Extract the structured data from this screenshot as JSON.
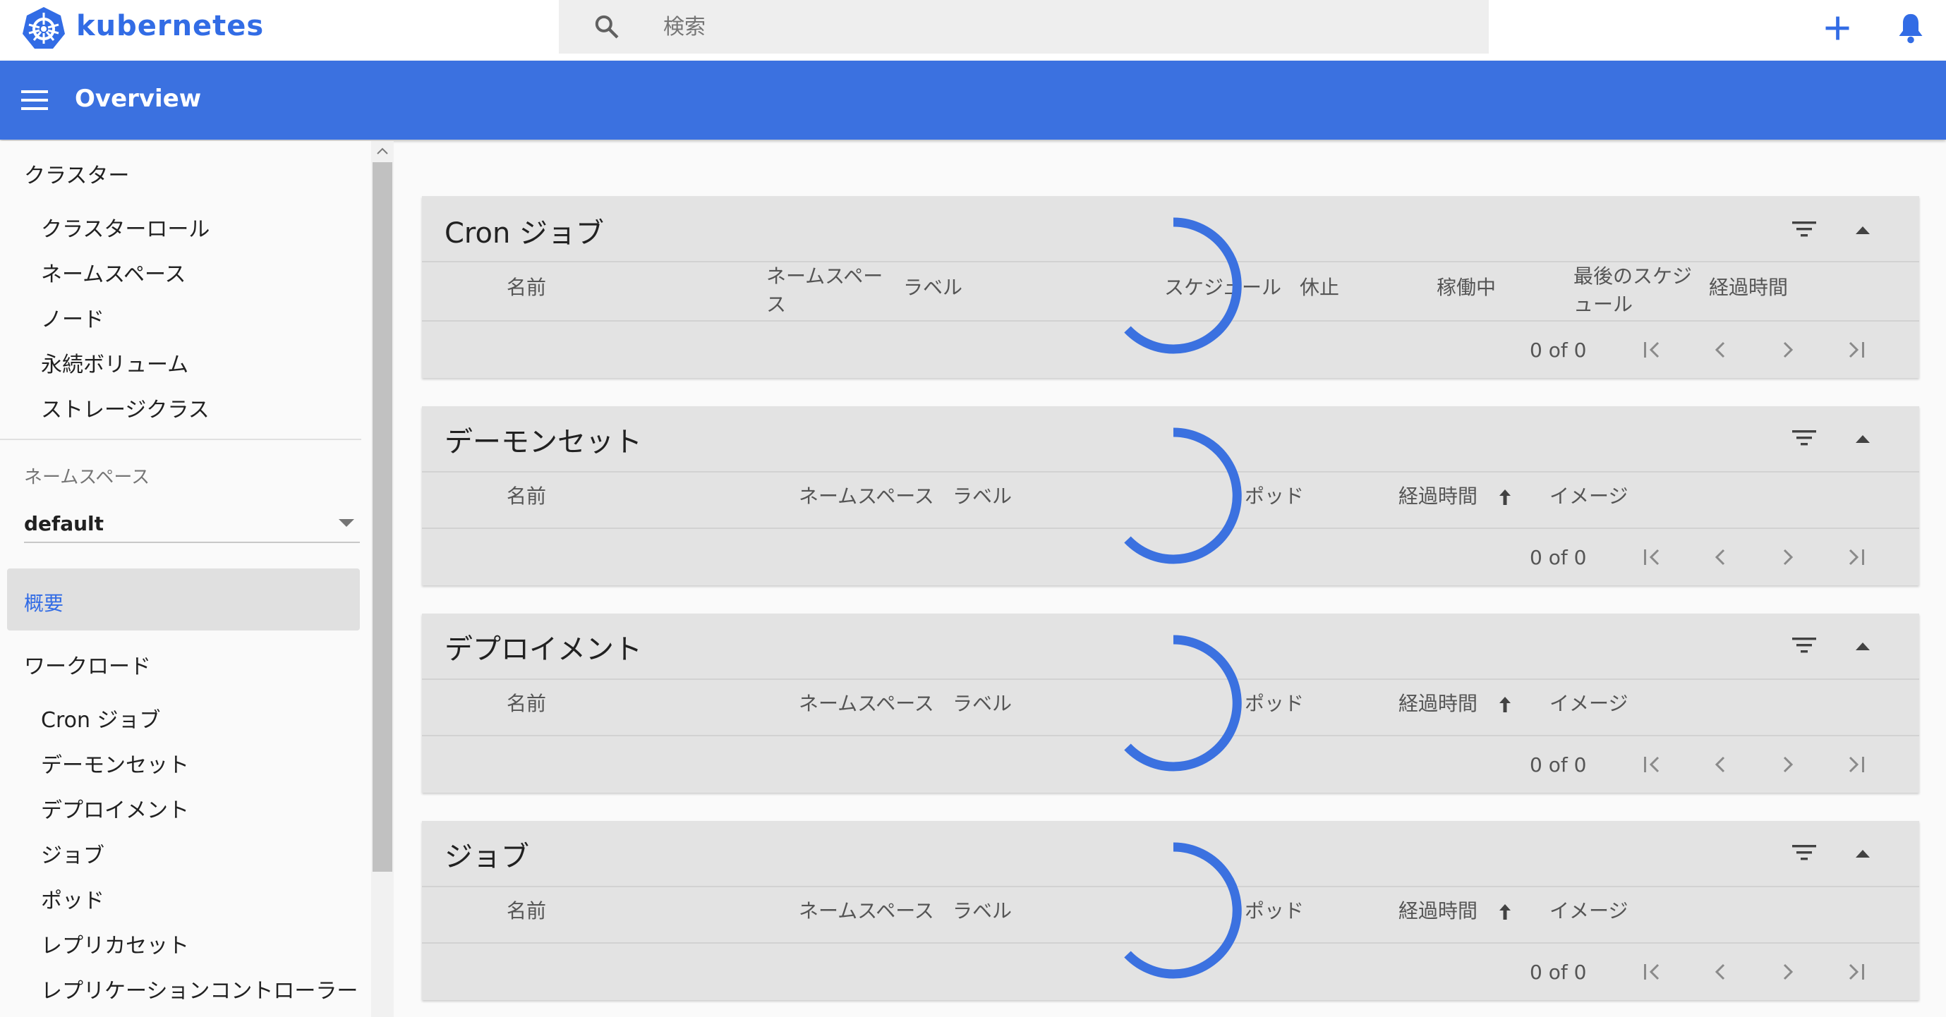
{
  "topbar": {
    "brand": "kubernetes",
    "search_placeholder": "検索",
    "icons": [
      "kubernetes-logo",
      "search-icon",
      "add-icon",
      "bell-icon"
    ]
  },
  "header": {
    "title": "Overview",
    "menu_icon": "menu-icon"
  },
  "sidebar": {
    "cluster_section": "クラスター",
    "cluster_items": [
      "クラスターロール",
      "ネームスペース",
      "ノード",
      "永続ボリューム",
      "ストレージクラス"
    ],
    "namespace_label": "ネームスペース",
    "namespace_value": "default",
    "overview": "概要",
    "workload_section": "ワークロード",
    "workload_items": [
      "Cron ジョブ",
      "デーモンセット",
      "デプロイメント",
      "ジョブ",
      "ポッド",
      "レプリカセット",
      "レプリケーションコントローラー"
    ]
  },
  "cards": [
    {
      "title": "Cron ジョブ",
      "columns": [
        "名前",
        "ネームスペース",
        "ラベル",
        "スケジュール",
        "休止",
        "稼働中",
        "最後のスケジュール",
        "経過時間"
      ],
      "pager": "0 of 0"
    },
    {
      "title": "デーモンセット",
      "columns": [
        "名前",
        "ネームスペース",
        "ラベル",
        "ポッド",
        "経過時間",
        "イメージ"
      ],
      "pager": "0 of 0"
    },
    {
      "title": "デプロイメント",
      "columns": [
        "名前",
        "ネームスペース",
        "ラベル",
        "ポッド",
        "経過時間",
        "イメージ"
      ],
      "pager": "0 of 0"
    },
    {
      "title": "ジョブ",
      "columns": [
        "名前",
        "ネームスペース",
        "ラベル",
        "ポッド",
        "経過時間",
        "イメージ"
      ],
      "pager": "0 of 0"
    }
  ],
  "colors": {
    "accent": "#326ce5",
    "header": "#3b71e0",
    "card": "#e3e3e3"
  }
}
